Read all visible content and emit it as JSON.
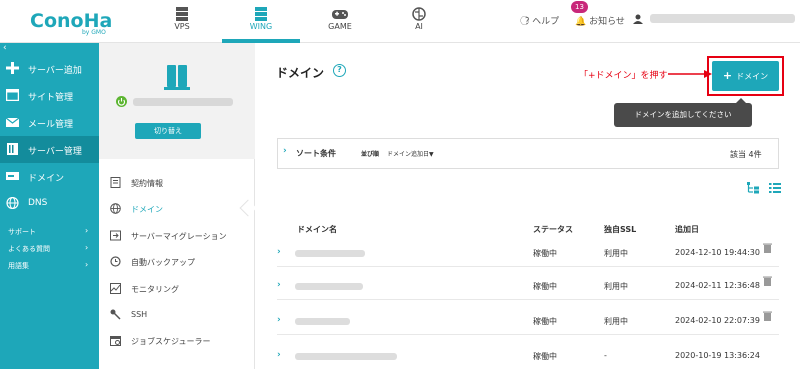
{
  "header": {
    "logo_text": "ConoHa",
    "logo_sub": "by GMO",
    "nav": [
      {
        "label": "VPS",
        "icon": "server-stack-icon",
        "active": false
      },
      {
        "label": "WING",
        "icon": "wing-icon",
        "active": true
      },
      {
        "label": "GAME",
        "icon": "gamepad-icon",
        "active": false
      },
      {
        "label": "AI",
        "icon": "ai-brain-icon",
        "active": false
      }
    ],
    "help_label": "ヘルプ",
    "notice_label": "お知らせ",
    "notice_count": "13"
  },
  "sidebar": {
    "collapse": "‹",
    "items": [
      {
        "label": "サーバー追加",
        "icon": "plus-icon"
      },
      {
        "label": "サイト管理",
        "icon": "site-icon"
      },
      {
        "label": "メール管理",
        "icon": "mail-icon"
      },
      {
        "label": "サーバー管理",
        "icon": "server-icon",
        "active": true
      },
      {
        "label": "ドメイン",
        "icon": "domain-icon"
      },
      {
        "label": "DNS",
        "icon": "globe-icon"
      }
    ],
    "sub": [
      {
        "label": "サポート"
      },
      {
        "label": "よくある質問"
      },
      {
        "label": "用語集"
      }
    ]
  },
  "panel": {
    "switch_label": "切り替え",
    "items": [
      {
        "label": "契約情報",
        "icon": "contract-icon"
      },
      {
        "label": "ドメイン",
        "icon": "globe-icon",
        "active": true
      },
      {
        "label": "サーバーマイグレーション",
        "icon": "migration-icon"
      },
      {
        "label": "自動バックアップ",
        "icon": "backup-icon"
      },
      {
        "label": "モニタリング",
        "icon": "monitoring-icon"
      },
      {
        "label": "SSH",
        "icon": "key-icon"
      },
      {
        "label": "ジョブスケジューラー",
        "icon": "scheduler-icon"
      }
    ]
  },
  "main": {
    "title": "ドメイン",
    "annotation": "「+ドメイン」を押す",
    "add_button_label": "ドメイン",
    "tooltip": "ドメインを追加してください",
    "sort": {
      "label": "ソート条件",
      "order_label": "並び順",
      "order_value": "ドメイン追加日▼"
    },
    "count": "該当 4件",
    "columns": [
      "ドメイン名",
      "ステータス",
      "独自SSL",
      "追加日"
    ],
    "rows": [
      {
        "status": "稼働中",
        "ssl": "利用中",
        "date": "2024-12-10 19:44:30"
      },
      {
        "status": "稼働中",
        "ssl": "利用中",
        "date": "2024-02-11 12:36:48"
      },
      {
        "status": "稼働中",
        "ssl": "利用中",
        "date": "2024-02-10 22:07:39"
      },
      {
        "status": "稼働中",
        "ssl": "-",
        "date": "2020-10-19 13:36:24"
      }
    ]
  },
  "colors": {
    "accent": "#1ea7b9",
    "highlight": "#e60012"
  }
}
